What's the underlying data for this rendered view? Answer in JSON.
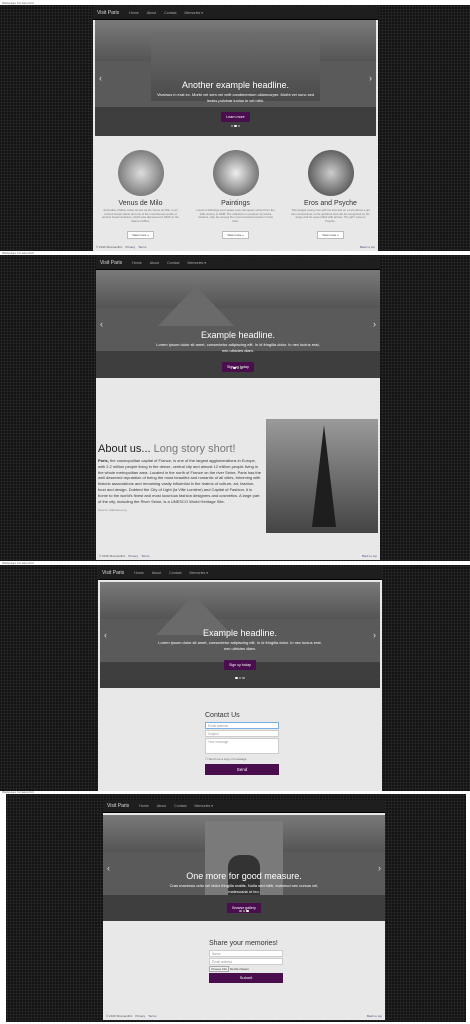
{
  "captions": [
    "Webpage Screenshot",
    "Webpage Screenshot",
    "Webpage Screenshot",
    "Webpage Screenshot"
  ],
  "nav": {
    "brand": "Visit Paris",
    "links": [
      "Home",
      "About",
      "Contact"
    ],
    "dropdown": "Memories"
  },
  "shot1": {
    "headline": "Another example headline.",
    "text": "Vivamus in erat ex. Morbi vel sem vel velit condimentum ullamcorper. Morbi vel nunc sed lectus pulvinar luctus in vel nibh.",
    "button": "Learn more",
    "features": [
      {
        "title": "Venus de Milo",
        "text": "Aphrodite of Milos, better known as the Venus de Milo, is an ancient Greek statue and one of the most famous works of ancient Greek sculpture, which was discovered in 1820 on the island of Milos.",
        "button": "View more »"
      },
      {
        "title": "Paintings",
        "text": "Louvre's Paintings encompass every European school from the 13th century to 1848. The collection is overseen by twelve curators, who are among the most renowned experts in their field.",
        "button": "View more »"
      },
      {
        "title": "Eros and Psyche",
        "text": "This winged young man with his bow tied on a rock above a girl lies unconscious, is the god Eros and can be recognized by his wings and his quiver filled with arrows. The girl's name is Psyche.",
        "button": "View more »"
      }
    ]
  },
  "shot2": {
    "headline": "Example headline.",
    "text": "Lorem ipsum dolor sit amet, consectetur adipiscing elit. In id fringilla dolor. In nec luctus erat, nec ultricies diam.",
    "button": "Sign up today",
    "about_title": "About us...",
    "about_sub": "Long story short!",
    "about_lead": "Paris,",
    "about_text": "the cosmopolitan capital of France, is one of the largest agglomerations in Europe, with 2.2 million people living in the dense, central city and almost 12 million people living in the whole metropolitan area. Located in the north of France on the river Seine, Paris has the well deserved reputation of being the most beautiful and romantic of all cities, brimming with historic associations and remaining vastly influential in the realms of culture, art, fashion, food and design. Dubbed the City of Light (la Ville Lumière) and Capital of Fashion, it is home to the world's finest and most luxurious fashion designers and cosmetics. A large part of the city, including the River Seine, is a UNESCO World Heritage Site.",
    "source": "Source: wikitravel.org"
  },
  "shot3": {
    "headline": "Example headline.",
    "text": "Lorem ipsum dolor sit amet, consectetur adipiscing elit. In id fringilla dolor. In nec luctus erat, nec ultricies diam.",
    "button": "Sign up today",
    "contact_title": "Contact Us",
    "email_ph": "Email address",
    "subject_ph": "Subject",
    "message_ph": "Your message",
    "copy_label": "Send me a copy of message",
    "send": "Send"
  },
  "shot4": {
    "headline": "One more for good measure.",
    "text": "Cras maximus odio vel dolor fringilla mattis. Nulla sed nibh, euismod nec cursus vel, malesuada ut leo.",
    "button": "Browse gallery",
    "share_title": "Share your memories!",
    "name_ph": "Name",
    "email_ph": "Email address",
    "choose_file": "Choose File",
    "no_file": "No file chosen",
    "submit": "Submit"
  },
  "footer": {
    "copy": "© 2016 Shamanthic",
    "privacy": "Privacy",
    "terms": "Terms",
    "back": "Back to top"
  },
  "colors": {
    "accent": "#4a0e4e",
    "nav": "#1e1e1e",
    "page": "#e8e8e8"
  }
}
